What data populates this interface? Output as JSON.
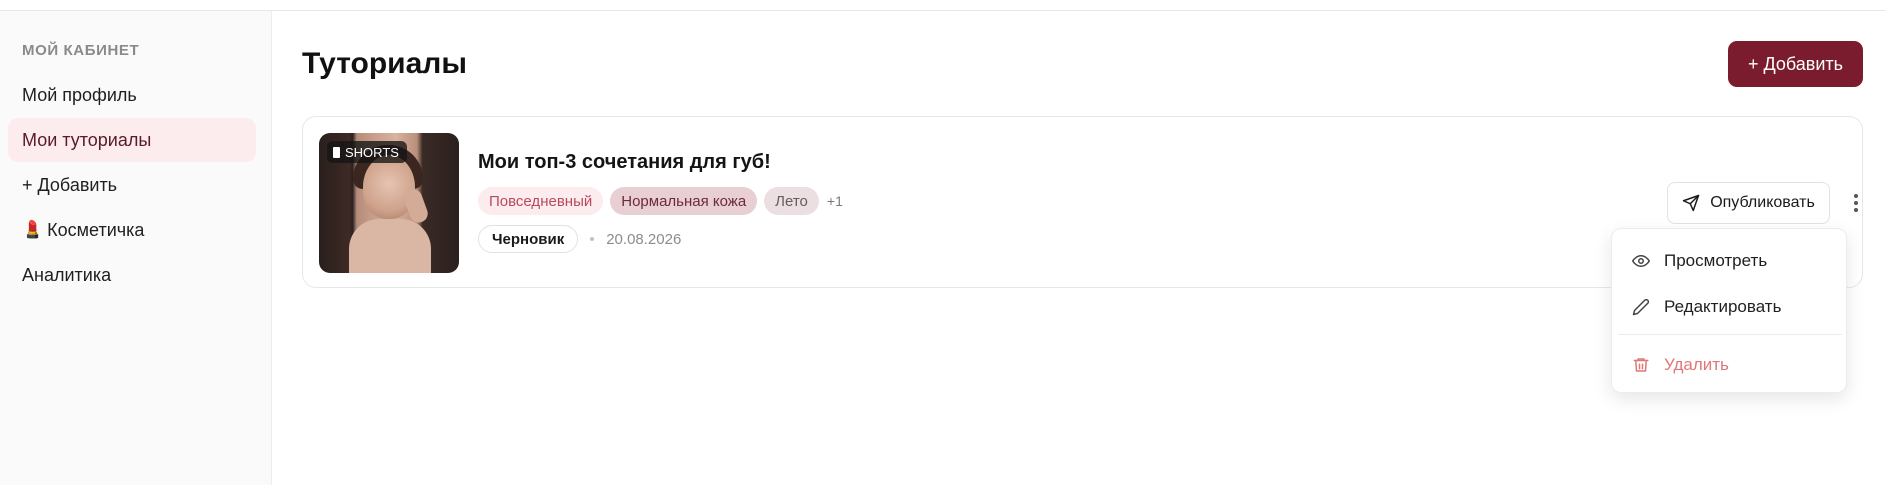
{
  "sidebar": {
    "section_label": "МОЙ КАБИНЕТ",
    "items": [
      {
        "label": "Мой профиль",
        "active": false
      },
      {
        "label": "Мои туториалы",
        "active": true
      },
      {
        "label": "+ Добавить",
        "active": false
      },
      {
        "label": "Косметичка",
        "emoji": "💄",
        "active": false
      },
      {
        "label": "Аналитика",
        "active": false
      }
    ]
  },
  "header": {
    "title": "Туториалы",
    "add_label": "+ Добавить"
  },
  "tutorial": {
    "badge": "SHORTS",
    "title": "Мои топ-3 сочетания для губ!",
    "tags": [
      "Повседневный",
      "Нормальная кожа",
      "Лето"
    ],
    "tags_more": "+1",
    "status": "Черновик",
    "date": "20.08.2026",
    "publish_label": "Опубликовать"
  },
  "menu": {
    "view_label": "Просмотреть",
    "edit_label": "Редактировать",
    "delete_label": "Удалить"
  },
  "colors": {
    "accent": "#7b1c2e",
    "active_bg": "#fcecee",
    "danger": "#e07676"
  },
  "icons": {
    "publish": "send-icon",
    "view": "eye-icon",
    "edit": "pencil-icon",
    "delete": "trash-icon",
    "more": "more-vertical-icon",
    "shorts": "phone-icon"
  }
}
